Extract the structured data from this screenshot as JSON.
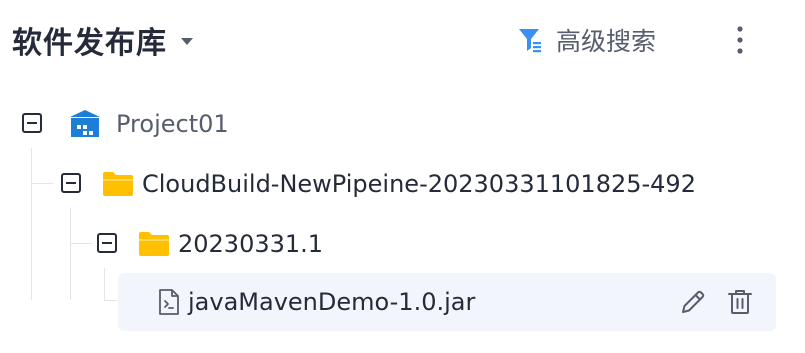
{
  "header": {
    "title": "软件发布库",
    "advanced_search_label": "高级搜索"
  },
  "tree": {
    "project": {
      "label": "Project01",
      "icon": "project-icon"
    },
    "pipeline_folder": {
      "label": "CloudBuild-NewPipeine-20230331101825-492",
      "icon": "folder-icon"
    },
    "version_folder": {
      "label": "20230331.1",
      "icon": "folder-icon"
    },
    "file": {
      "label": "javaMavenDemo-1.0.jar",
      "icon": "file-icon"
    }
  },
  "colors": {
    "folder": "#ffc000",
    "project": "#1d7ed8",
    "text": "#252b3a",
    "selected_row": "#f2f5fc",
    "filter_icon": "#3a8ff0"
  }
}
